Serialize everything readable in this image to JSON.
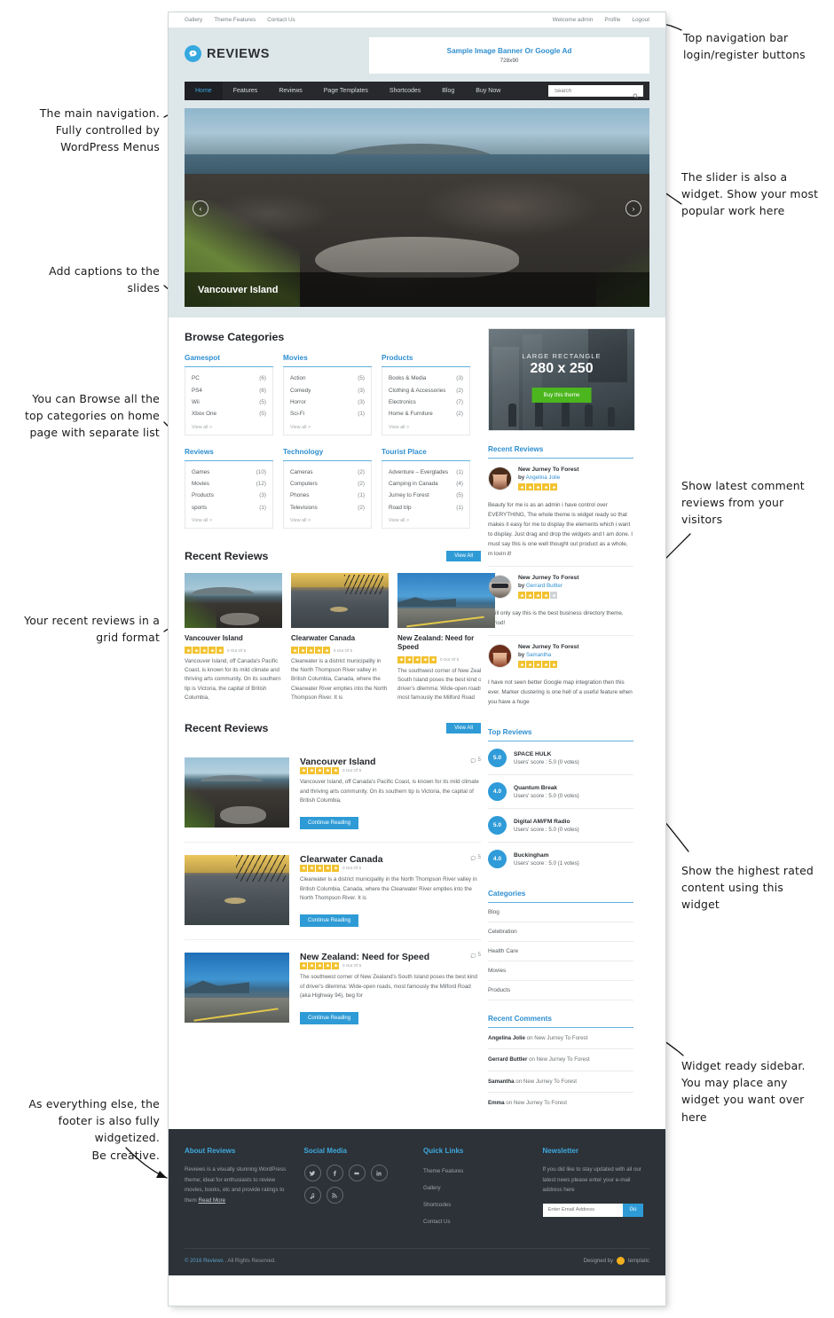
{
  "topbar": {
    "left_links": [
      "Gallery",
      "Theme Features",
      "Contact Us"
    ],
    "welcome": "Welcome admin",
    "right_links": [
      "Profile",
      "Logout"
    ]
  },
  "header": {
    "logo_text": "REVIEWS",
    "banner_title": "Sample Image Banner Or Google Ad",
    "banner_size": "728x90"
  },
  "nav": {
    "items": [
      "Home",
      "Features",
      "Reviews",
      "Page Templates",
      "Shortcodes",
      "Blog",
      "Buy Now"
    ],
    "active": "Home",
    "search_placeholder": "Search"
  },
  "slider": {
    "caption": "Vancouver Island",
    "prev": "‹",
    "next": "›"
  },
  "browse": {
    "title": "Browse Categories",
    "view_all": "View all >",
    "columns": [
      {
        "name": "Gamespot",
        "rows": [
          {
            "label": "PC",
            "count": "(6)"
          },
          {
            "label": "PS4",
            "count": "(6)"
          },
          {
            "label": "Wii",
            "count": "(5)"
          },
          {
            "label": "Xbox One",
            "count": "(5)"
          }
        ]
      },
      {
        "name": "Movies",
        "rows": [
          {
            "label": "Action",
            "count": "(5)"
          },
          {
            "label": "Comedy",
            "count": "(3)"
          },
          {
            "label": "Horror",
            "count": "(3)"
          },
          {
            "label": "Sci-Fi",
            "count": "(1)"
          }
        ]
      },
      {
        "name": "Products",
        "rows": [
          {
            "label": "Books & Media",
            "count": "(3)"
          },
          {
            "label": "Clothing & Accessories",
            "count": "(2)"
          },
          {
            "label": "Electronics",
            "count": "(7)"
          },
          {
            "label": "Home & Furniture",
            "count": "(2)"
          }
        ]
      },
      {
        "name": "Reviews",
        "rows": [
          {
            "label": "Games",
            "count": "(10)"
          },
          {
            "label": "Movies",
            "count": "(12)"
          },
          {
            "label": "Products",
            "count": "(3)"
          },
          {
            "label": "sports",
            "count": "(1)"
          }
        ]
      },
      {
        "name": "Technology",
        "rows": [
          {
            "label": "Cameras",
            "count": "(2)"
          },
          {
            "label": "Computers",
            "count": "(2)"
          },
          {
            "label": "Phones",
            "count": "(1)"
          },
          {
            "label": "Televisions",
            "count": "(2)"
          }
        ]
      },
      {
        "name": "Tourist Place",
        "rows": [
          {
            "label": "Adventure – Everglades",
            "count": "(1)"
          },
          {
            "label": "Camping in Canada",
            "count": "(4)"
          },
          {
            "label": "Jurney to Forest",
            "count": "(5)"
          },
          {
            "label": "Road trip",
            "count": "(1)"
          }
        ]
      }
    ]
  },
  "recent_grid": {
    "title": "Recent Reviews",
    "view_all": "View All",
    "rating_label": "0 Out Of 5",
    "cards": [
      {
        "title": "Vancouver Island",
        "excerpt": "Vancouver Island, off Canada's Pacific Coast, is known for its mild climate and thriving arts community. On its southern tip is Victoria, the capital of British Columbia,"
      },
      {
        "title": "Clearwater Canada",
        "excerpt": "Clearwater is a district municipality in the North Thompson River valley in British Columbia, Canada, where the Clearwater River empties into the North Thompson River. It is"
      },
      {
        "title": "New Zealand: Need for Speed",
        "excerpt": "The southwest corner of New Zealand's South Island poses the best kind of driver's dilemma: Wide-open roads, most famously the Milford Road"
      }
    ]
  },
  "recent_list": {
    "title": "Recent Reviews",
    "view_all": "View All",
    "rating_label": "0 Out Of 5",
    "read_more": "Continue Reading",
    "items": [
      {
        "title": "Vancouver Island",
        "comments": "5",
        "excerpt": "Vancouver Island, off Canada's Pacific Coast, is known for its mild climate and thriving arts community. On its southern tip is Victoria, the capital of British Columbia,"
      },
      {
        "title": "Clearwater Canada",
        "comments": "5",
        "excerpt": "Clearwater is a district municipality in the North Thompson River valley in British Columbia, Canada, where the Clearwater River empties into the North Thompson River. It is"
      },
      {
        "title": "New Zealand: Need for Speed",
        "comments": "5",
        "excerpt": "The southwest corner of New Zealand's South Island poses the best kind of driver's dilemma: Wide-open roads, most famously the Milford Road (aka Highway 94), beg for"
      }
    ]
  },
  "sidebar": {
    "ad": {
      "label": "LARGE RECTANGLE",
      "size": "280 x 250",
      "button": "Buy this theme"
    },
    "recent_reviews": {
      "title": "Recent Reviews",
      "items": [
        {
          "title": "New Jurney To Forest",
          "by_prefix": "by",
          "author": "Angelina Jolie",
          "stars": 5,
          "text": "Beauty for me is as an admin i have control over EVERYTHING, The whole theme is widget ready so that makes it easy for me to display the elements which i want to display. Just drag and drop the widgets and I am done. I must say this is one well thought out product as a whole, m lovin it!"
        },
        {
          "title": "New Jurney To Forest",
          "by_prefix": "by",
          "author": "Gerrard Buttler",
          "stars": 4,
          "text": "I will only say this is the best business directory theme, period!"
        },
        {
          "title": "New Jurney To Forest",
          "by_prefix": "by",
          "author": "Samantha",
          "stars": 5,
          "text": "I have not seen better Google map integration then this ever. Marker clustering is one hell of a useful feature when you have a huge"
        }
      ]
    },
    "top_reviews": {
      "title": "Top Reviews",
      "items": [
        {
          "score": "5.0",
          "name": "SPACE HULK",
          "users": "Users' score : 5.0 (0 votes)"
        },
        {
          "score": "4.0",
          "name": "Quantum Break",
          "users": "Users' score : 5.0 (0 votes)"
        },
        {
          "score": "5.0",
          "name": "Digital AM/FM Radio",
          "users": "Users' score : 5.0 (0 votes)"
        },
        {
          "score": "4.0",
          "name": "Buckingham",
          "users": "Users' score : 5.0 (1 votes)"
        }
      ]
    },
    "categories": {
      "title": "Categories",
      "items": [
        "Blog",
        "Celebration",
        "Health Care",
        "Movies",
        "Products"
      ]
    },
    "recent_comments": {
      "title": "Recent Comments",
      "items": [
        {
          "author": "Angelina Jolie",
          "rest": " on New Jurney To Forest"
        },
        {
          "author": "Gerrard Buttler",
          "rest": " on New Jurney To Forest"
        },
        {
          "author": "Samantha",
          "rest": " on New Jurney To Forest"
        },
        {
          "author": "Emma",
          "rest": " on New Jurney To Forest"
        }
      ]
    }
  },
  "footer": {
    "about": {
      "title": "About Reviews",
      "text": "Reviews is a visually stunning WordPress theme; ideal for enthusiasts to review movies, books, etc and provide ratings to them ",
      "read_more": "Read More"
    },
    "social": {
      "title": "Social Media",
      "icons": [
        "twitter-icon",
        "facebook-icon",
        "flickr-icon",
        "linkedin-icon",
        "music-icon",
        "rss-icon"
      ]
    },
    "quick_links": {
      "title": "Quick Links",
      "items": [
        "Theme Features",
        "Gallery",
        "Shortcodes",
        "Contact Us"
      ]
    },
    "newsletter": {
      "title": "Newsletter",
      "text": "If you did like to stay updated with all our latest news please enter your e-mail address here",
      "placeholder": "Enter Email Address",
      "button": "Go"
    },
    "copyright_link": "© 2016 Reviews",
    "copyright_rest": " . All Rights Reserved.",
    "designed_by": "Designed by",
    "designer": "templatic"
  },
  "annotations": {
    "a1": "The main navigation.\nFully controlled by\nWordPress Menus",
    "a2": "Add captions to the\nslides",
    "a3": "You can Browse all the\ntop categories on home\npage with separate list",
    "a4": "Your recent reviews in a\ngrid format",
    "a5": "As everything else, the\nfooter is also fully\nwidgetized.\nBe creative.",
    "b1": "Top navigation bar\nlogin/register buttons",
    "b2": "The slider is also a\nwidget. Show your most\npopular work here",
    "b3": "Show latest comment\nreviews from your\nvisitors",
    "b4": "Show the highest rated\ncontent using this\nwidget",
    "b5": "Widget ready sidebar.\nYou may place any\nwidget you want over\nhere"
  },
  "colors": {
    "accent_blue": "#2e9bd6",
    "link_blue": "#2f8fd0",
    "header_bg": "#dde6e9",
    "nav_bg": "#27292c",
    "footer_bg": "#2c3237",
    "star": "#f2c230",
    "ad_button_green": "#4cb61e"
  }
}
